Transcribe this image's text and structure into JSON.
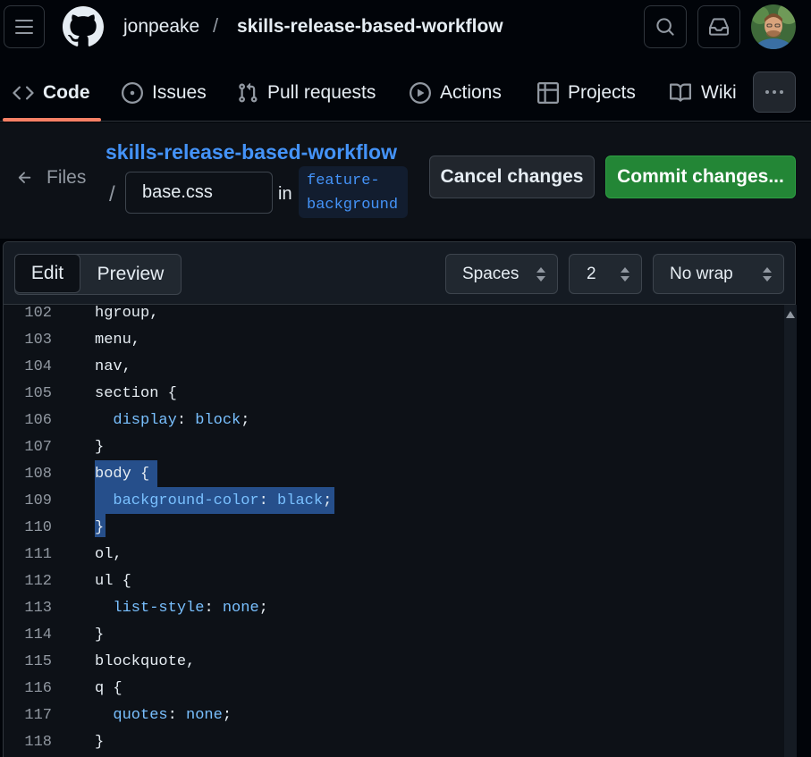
{
  "header": {
    "owner": "jonpeake",
    "separator": "/",
    "repo": "skills-release-based-workflow",
    "icons": {
      "menu": "hamburger-icon",
      "logo": "github-mark-icon",
      "search": "search-icon",
      "inbox": "inbox-icon",
      "avatar": "user-avatar"
    }
  },
  "nav": {
    "tabs": [
      {
        "label": "Code",
        "icon": "code-icon",
        "selected": true
      },
      {
        "label": "Issues",
        "icon": "issue-opened-icon"
      },
      {
        "label": "Pull requests",
        "icon": "git-pull-request-icon"
      },
      {
        "label": "Actions",
        "icon": "play-icon"
      },
      {
        "label": "Projects",
        "icon": "table-icon"
      },
      {
        "label": "Wiki",
        "icon": "book-icon"
      }
    ],
    "more_icon": "kebab-horizontal-icon"
  },
  "subbar": {
    "back_label": "Files",
    "repo_link": "skills-release-based-workflow",
    "path_separator": "/",
    "filename": "base.css",
    "in_label": "in",
    "branch_line1": "feature-",
    "branch_line2": "background",
    "cancel_label": "Cancel changes",
    "commit_label": "Commit changes..."
  },
  "toolbar": {
    "edit_label": "Edit",
    "preview_label": "Preview",
    "indent_mode": "Spaces",
    "indent_size": "2",
    "wrap_mode": "No wrap"
  },
  "colors": {
    "accent": "#4493f8",
    "commit_green": "#238636",
    "selected_tab_underline": "#f78166",
    "selection": "#264f8b"
  },
  "code": {
    "lines": [
      {
        "n": "102",
        "text": "hgroup,"
      },
      {
        "n": "103",
        "text": "menu,"
      },
      {
        "n": "104",
        "text": "nav,"
      },
      {
        "n": "105",
        "text": "section {"
      },
      {
        "n": "106",
        "prop": "display",
        "value": "block"
      },
      {
        "n": "107",
        "text": "}"
      },
      {
        "n": "108",
        "text": "body {"
      },
      {
        "n": "109",
        "prop": "background-color",
        "value": "black"
      },
      {
        "n": "110",
        "text": "}"
      },
      {
        "n": "111",
        "text": "ol,"
      },
      {
        "n": "112",
        "text": "ul {"
      },
      {
        "n": "113",
        "prop": "list-style",
        "value": "none"
      },
      {
        "n": "114",
        "text": "}"
      },
      {
        "n": "115",
        "text": "blockquote,"
      },
      {
        "n": "116",
        "text": "q {"
      },
      {
        "n": "117",
        "prop": "quotes",
        "value": "none"
      },
      {
        "n": "118",
        "text": "}"
      }
    ]
  }
}
